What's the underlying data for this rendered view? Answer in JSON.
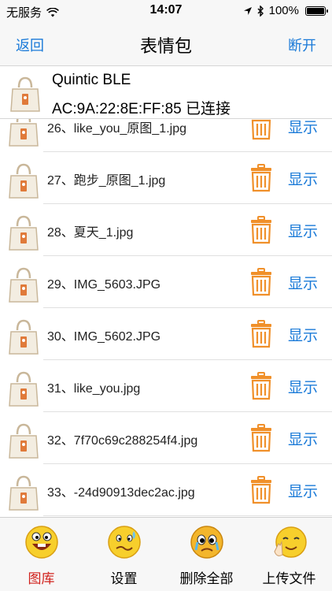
{
  "status": {
    "carrier": "无服务",
    "time": "14:07",
    "battery": "100%"
  },
  "nav": {
    "back": "返回",
    "title": "表情包",
    "disconnect": "断开"
  },
  "device": {
    "name": "Quintic BLE",
    "address": "AC:9A:22:8E:FF:85  已连接"
  },
  "files": [
    {
      "name": "26、like_you_原图_1.jpg",
      "action": "显示"
    },
    {
      "name": "27、跑步_原图_1.jpg",
      "action": "显示"
    },
    {
      "name": "28、夏天_1.jpg",
      "action": "显示"
    },
    {
      "name": "29、IMG_5603.JPG",
      "action": "显示"
    },
    {
      "name": "30、IMG_5602.JPG",
      "action": "显示"
    },
    {
      "name": "31、like_you.jpg",
      "action": "显示"
    },
    {
      "name": "32、7f70c69c288254f4.jpg",
      "action": "显示"
    },
    {
      "name": "33、-24d90913dec2ac.jpg",
      "action": "显示"
    }
  ],
  "tabs": [
    {
      "label": "图库",
      "icon": "gallery-emoji-icon",
      "active": true
    },
    {
      "label": "设置",
      "icon": "settings-emoji-icon",
      "active": false
    },
    {
      "label": "删除全部",
      "icon": "delete-all-emoji-icon",
      "active": false
    },
    {
      "label": "上传文件",
      "icon": "upload-emoji-icon",
      "active": false
    }
  ],
  "colors": {
    "accent": "#1a7ad8",
    "trash": "#f0902a",
    "active_tab": "#d0201b"
  }
}
